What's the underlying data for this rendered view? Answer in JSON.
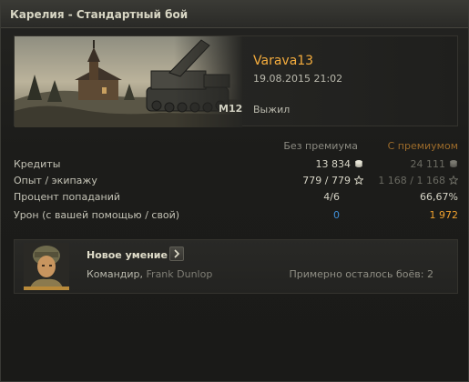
{
  "window": {
    "title": "Карелия - Стандартный бой"
  },
  "battle": {
    "player": "Varava13",
    "datetime": "19.08.2015 21:02",
    "tank": "M12",
    "status": "Выжил"
  },
  "stats": {
    "header_no_premium": "Без премиума",
    "header_premium": "С премиумом",
    "rows": [
      {
        "label": "Кредиты",
        "no_premium": "13 834",
        "premium": "24 111",
        "icon": "credits-icon"
      },
      {
        "label": "Опыт / экипажу",
        "no_premium": "779 / 779",
        "premium": "1 168 / 1 168",
        "icon": "experience-star-icon"
      },
      {
        "label": "Процент попаданий",
        "no_premium": "4/6",
        "premium": "66,67%"
      },
      {
        "label": "Урон (с вашей помощью / свой)",
        "no_premium": "0",
        "premium": "1 972"
      }
    ]
  },
  "skill": {
    "title": "Новое умение",
    "role": "Командир,",
    "name": "Frank Dunlop",
    "battles_left": "Примерно осталось боёв: 2"
  },
  "colors": {
    "accent_orange": "#f4ac3d",
    "damage_assist_blue": "#3f8fd8",
    "damage_own_gold": "#f1a22e"
  }
}
